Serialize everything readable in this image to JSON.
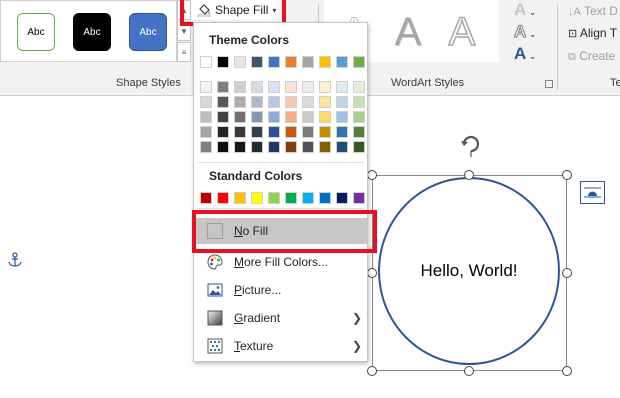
{
  "ribbon": {
    "shape_styles_label": "Shape Styles",
    "wordart_styles_label": "WordArt Styles",
    "style_presets": [
      {
        "label": "Abc",
        "fill": "#ffffff",
        "border": "#70ad47",
        "text": "#000000"
      },
      {
        "label": "Abc",
        "fill": "#000000",
        "border": "#000000",
        "text": "#ffffff"
      },
      {
        "label": "Abc",
        "fill": "#4472c4",
        "border": "#2f5597",
        "text": "#ffffff"
      }
    ],
    "shape_fill_label": "Shape Fill",
    "wordart_letters": [
      "A",
      "A",
      "A"
    ],
    "text_tools": {
      "text_direction": "Text D",
      "align_text": "Align T",
      "create_link": "Create",
      "cut_label": "Te"
    }
  },
  "menu": {
    "theme_colors_heading": "Theme Colors",
    "standard_colors_heading": "Standard Colors",
    "theme_top_row": [
      "#ffffff",
      "#000000",
      "#e7e6e6",
      "#44546a",
      "#4472c4",
      "#ed7d31",
      "#a5a5a5",
      "#ffc000",
      "#5b9bd5",
      "#70ad47"
    ],
    "theme_shades": [
      [
        "#f2f2f2",
        "#808080",
        "#d0cece",
        "#d6dce4",
        "#d9e2f3",
        "#fbe4d5",
        "#ededed",
        "#fff2cc",
        "#deeaf6",
        "#e2efd9"
      ],
      [
        "#d9d9d9",
        "#595959",
        "#aeabab",
        "#adb9ca",
        "#b4c6e7",
        "#f7caac",
        "#dbdbdb",
        "#ffe599",
        "#bdd6ee",
        "#c5e0b3"
      ],
      [
        "#bfbfbf",
        "#404040",
        "#757070",
        "#8496b0",
        "#8eaadb",
        "#f4b083",
        "#c9c9c9",
        "#ffd966",
        "#9cc3e5",
        "#a8d08d"
      ],
      [
        "#a6a6a6",
        "#262626",
        "#3a3838",
        "#323f4f",
        "#2f5496",
        "#c45911",
        "#7b7b7b",
        "#bf8f00",
        "#2e74b5",
        "#538135"
      ],
      [
        "#808080",
        "#0d0d0d",
        "#171616",
        "#222a35",
        "#1f3864",
        "#833c0b",
        "#525252",
        "#7f6000",
        "#1f4e79",
        "#375623"
      ]
    ],
    "standard_colors": [
      "#c00000",
      "#ff0000",
      "#ffc000",
      "#ffff00",
      "#92d050",
      "#00b050",
      "#00b0f0",
      "#0070c0",
      "#002060",
      "#7030a0"
    ],
    "items": [
      {
        "label": "No Fill",
        "icon": "no-fill-swatch-icon"
      },
      {
        "label": "More Fill Colors...",
        "icon": "palette-icon"
      },
      {
        "label": "Picture...",
        "icon": "picture-icon"
      },
      {
        "label": "Gradient",
        "icon": "gradient-icon",
        "submenu": true
      },
      {
        "label": "Texture",
        "icon": "texture-icon",
        "submenu": true
      }
    ]
  },
  "document": {
    "shape_text": "Hello, World!"
  },
  "colors": {
    "highlight_frame": "#e81123",
    "shape_outline": "#2f5597",
    "hover_bg": "#c8c6c4"
  }
}
